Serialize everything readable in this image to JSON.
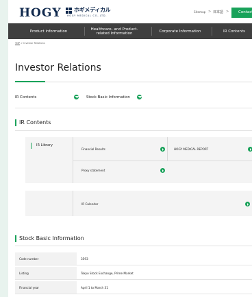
{
  "header": {
    "logo_text": "HOGY",
    "logo_kana": "ホギメディカル",
    "logo_en": "HOGY MEDICAL CO.,LTD.",
    "sitemap": "Sitemap",
    "sep": ">",
    "language": "日本語",
    "contact": "Contact"
  },
  "nav": {
    "items": [
      "Product information",
      "Healthcare- and Product-related Information",
      "Corporate Information",
      "IR Contents"
    ]
  },
  "breadcrumb": {
    "home": "TOP",
    "sep": ">",
    "current": "Investor Relations"
  },
  "page_title": "Investor Relations",
  "anchors": [
    "IR Contents",
    "Stock Basic Information"
  ],
  "ir_section": {
    "heading": "IR Contents",
    "library_label": "IR Library",
    "links": [
      "Financial Results",
      "HOGY MEDICAL REPORT",
      "Proxy statement"
    ],
    "calendar": "IR Calendar"
  },
  "stock_section": {
    "heading": "Stock Basic Information",
    "rows": [
      {
        "label": "Code number",
        "value": "3593"
      },
      {
        "label": "Listing",
        "value": "Tokyo Stock Exchange, Prime Market"
      },
      {
        "label": "Financial year",
        "value": "April 1 to March 31"
      }
    ]
  },
  "colors": {
    "accent": "#19a25a",
    "nav_bg": "#3f3f3f",
    "brand_navy": "#10294d",
    "side_bg": "#e8f3ee"
  }
}
